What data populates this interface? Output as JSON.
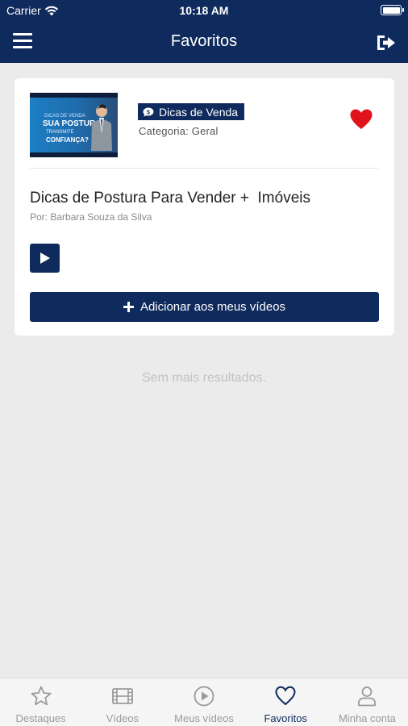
{
  "status_bar": {
    "carrier": "Carrier",
    "time": "10:18 AM"
  },
  "header": {
    "title": "Favoritos",
    "menu_icon": "hamburger-icon",
    "logout_icon": "logout-icon"
  },
  "card": {
    "thumbnail": {
      "line1": "DICAS DE VENDA",
      "line2": "SUA POSTURA",
      "line3": "TRANSMITE",
      "line4": "CONFIANÇA?"
    },
    "tag_label": "Dicas de Venda",
    "category": "Categoria: Geral",
    "favorited": true,
    "title": "Dicas de Postura Para Vender +  Imóveis",
    "author": "Por: Barbara Souza da Silva",
    "add_button_label": "Adicionar aos meus vídeos"
  },
  "empty_message": "Sem mais resultados.",
  "tabbar": {
    "items": [
      {
        "label": "Destaques",
        "icon": "star-icon"
      },
      {
        "label": "Vídeos",
        "icon": "film-icon"
      },
      {
        "label": "Meus vídeos",
        "icon": "play-circle-icon"
      },
      {
        "label": "Favoritos",
        "icon": "heart-icon",
        "active": true
      },
      {
        "label": "Minha conta",
        "icon": "user-icon"
      }
    ]
  },
  "colors": {
    "primary": "#0f2a5c",
    "heart": "#e0121b",
    "background": "#ebebeb"
  }
}
